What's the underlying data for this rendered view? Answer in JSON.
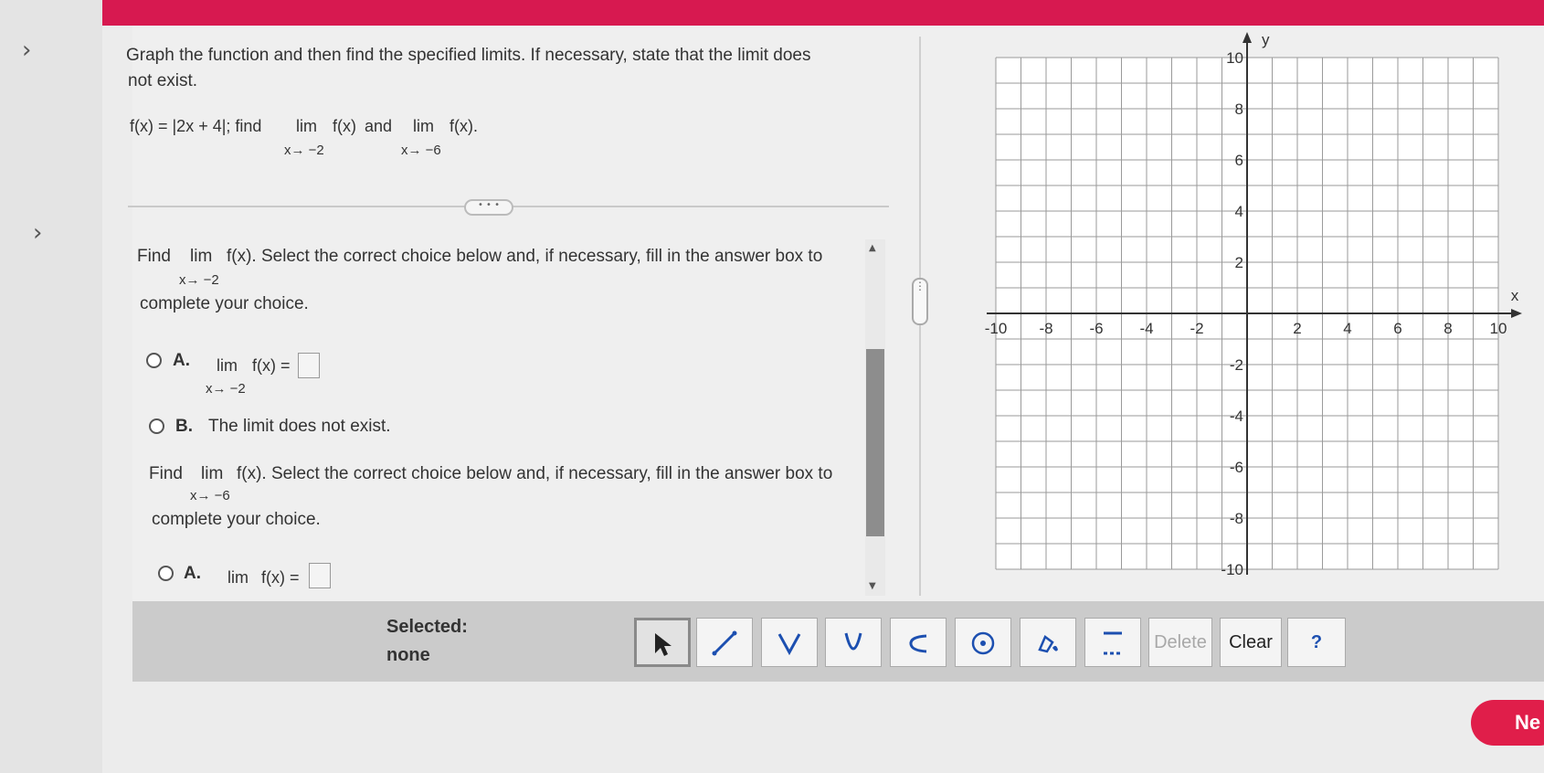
{
  "question": {
    "instruction_line1": "Graph the function and then find the specified limits. If necessary, state that the limit does",
    "instruction_line2": "not exist.",
    "function_text": "f(x) = |2x + 4|; find",
    "lim1": "lim",
    "lim1_fx": "f(x)",
    "and": "and",
    "lim2": "lim",
    "lim2_fx": "f(x).",
    "sub1": "x→ −2",
    "sub2": "x→ −6"
  },
  "part1": {
    "find": "Find",
    "lim": "lim",
    "fx_text": "f(x). Select the correct choice below and, if necessary, fill in the answer box to",
    "sub": "x→ −2",
    "complete": "complete your choice.",
    "optionA_letter": "A.",
    "optionA_lim": "lim",
    "optionA_fx": "f(x) =",
    "optionA_sub": "x→ −2",
    "optionB_letter": "B.",
    "optionB_text": "The limit does not exist."
  },
  "part2": {
    "find": "Find",
    "lim": "lim",
    "fx_text": "f(x). Select the correct choice below and, if necessary, fill in the answer box to",
    "sub": "x→ −6",
    "complete": "complete your choice.",
    "optionA_letter": "A.",
    "optionA_lim": "lim",
    "optionA_fx": "f(x) ="
  },
  "graph": {
    "x_label": "x",
    "y_label": "y",
    "x_ticks": [
      "-10",
      "-8",
      "-6",
      "-4",
      "-2",
      "2",
      "4",
      "6",
      "8",
      "10"
    ],
    "y_ticks": [
      "10",
      "8",
      "6",
      "4",
      "2",
      "-2",
      "-4",
      "-6",
      "-8",
      "-10"
    ]
  },
  "toolbar": {
    "selected_label": "Selected:",
    "selected_value": "none",
    "delete_label": "Delete",
    "clear_label": "Clear",
    "help_label": "?"
  },
  "nav": {
    "next_label": "Ne"
  },
  "colors": {
    "topbar": "#d71950",
    "tool_icon": "#1c4fb0",
    "next_button": "#e01e4a"
  }
}
